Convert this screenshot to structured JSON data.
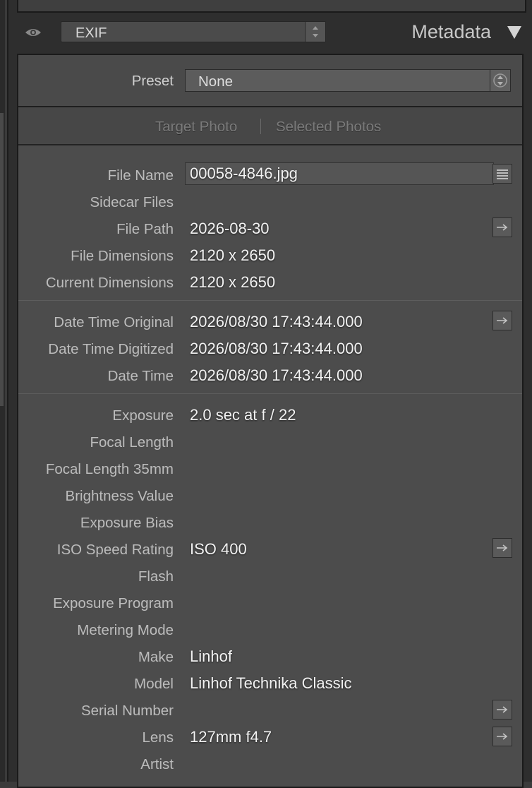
{
  "header": {
    "preset_label": "EXIF",
    "panel_title": "Metadata"
  },
  "preset": {
    "label": "Preset",
    "value": "None"
  },
  "tabs": [
    {
      "label": "Target Photo"
    },
    {
      "label": "Selected Photos"
    }
  ],
  "fields": {
    "file_name": {
      "label": "File Name",
      "value": "00058-4846.jpg"
    },
    "sidecar_files": {
      "label": "Sidecar Files",
      "value": ""
    },
    "file_path": {
      "label": "File Path",
      "value": "2026-08-30"
    },
    "file_dimensions": {
      "label": "File Dimensions",
      "value": "2120 x 2650"
    },
    "current_dimensions": {
      "label": "Current Dimensions",
      "value": "2120 x 2650"
    },
    "date_time_original": {
      "label": "Date Time Original",
      "value": "2026/08/30 17:43:44.000"
    },
    "date_time_digitized": {
      "label": "Date Time Digitized",
      "value": "2026/08/30 17:43:44.000"
    },
    "date_time": {
      "label": "Date Time",
      "value": "2026/08/30 17:43:44.000"
    },
    "exposure": {
      "label": "Exposure",
      "value": "2.0 sec at f / 22"
    },
    "focal_length": {
      "label": "Focal Length",
      "value": ""
    },
    "focal_length_35mm": {
      "label": "Focal Length 35mm",
      "value": ""
    },
    "brightness_value": {
      "label": "Brightness Value",
      "value": ""
    },
    "exposure_bias": {
      "label": "Exposure Bias",
      "value": ""
    },
    "iso_speed_rating": {
      "label": "ISO Speed Rating",
      "value": "ISO 400"
    },
    "flash": {
      "label": "Flash",
      "value": ""
    },
    "exposure_program": {
      "label": "Exposure Program",
      "value": ""
    },
    "metering_mode": {
      "label": "Metering Mode",
      "value": ""
    },
    "make": {
      "label": "Make",
      "value": "Linhof"
    },
    "model": {
      "label": "Model",
      "value": "Linhof Technika Classic"
    },
    "serial_number": {
      "label": "Serial Number",
      "value": ""
    },
    "lens": {
      "label": "Lens",
      "value": "127mm f4.7"
    },
    "artist": {
      "label": "Artist",
      "value": ""
    }
  },
  "icons": {
    "visibility": "eye-icon",
    "collapse": "triangle-down-icon",
    "file_list": "list-icon",
    "go_to": "arrow-right-icon"
  }
}
